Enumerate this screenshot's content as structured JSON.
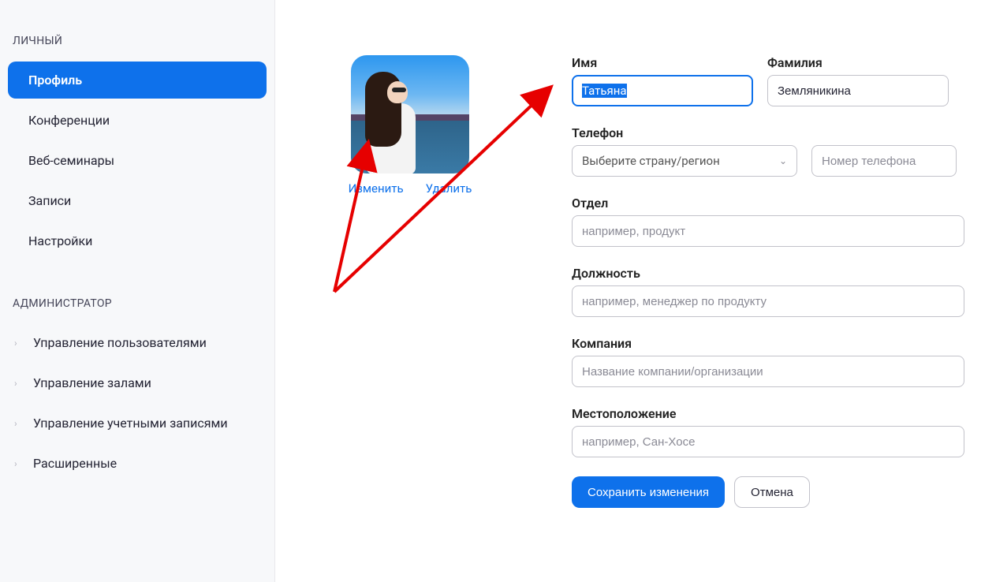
{
  "sidebar": {
    "personal_label": "ЛИЧНЫЙ",
    "items": [
      {
        "label": "Профиль"
      },
      {
        "label": "Конференции"
      },
      {
        "label": "Веб-семинары"
      },
      {
        "label": "Записи"
      },
      {
        "label": "Настройки"
      }
    ],
    "admin_label": "АДМИНИСТРАТОР",
    "admin_items": [
      {
        "label": "Управление пользователями"
      },
      {
        "label": "Управление залами"
      },
      {
        "label": "Управление учетными записями"
      },
      {
        "label": "Расширенные"
      }
    ]
  },
  "avatar": {
    "change": "Изменить",
    "delete": "Удалить"
  },
  "form": {
    "first_name_label": "Имя",
    "first_name_value": "Татьяна",
    "last_name_label": "Фамилия",
    "last_name_value": "Земляникина",
    "phone_label": "Телефон",
    "country_select": "Выберите страну/регион",
    "phone_placeholder": "Номер телефона",
    "department_label": "Отдел",
    "department_placeholder": "например, продукт",
    "position_label": "Должность",
    "position_placeholder": "например, менеджер по продукту",
    "company_label": "Компания",
    "company_placeholder": "Название компании/организации",
    "location_label": "Местоположение",
    "location_placeholder": "например, Сан-Хосе",
    "save_btn": "Сохранить изменения",
    "cancel_btn": "Отмена"
  }
}
